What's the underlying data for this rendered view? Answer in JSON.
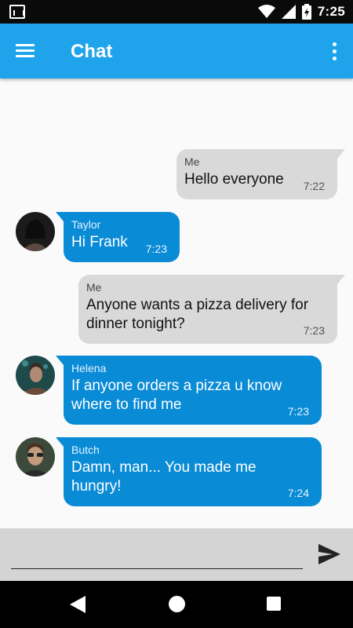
{
  "status_bar": {
    "time": "7:25",
    "icons": [
      "screen-capture-icon",
      "wifi-icon",
      "cellular-signal-icon",
      "battery-charging-icon"
    ]
  },
  "app_bar": {
    "title": "Chat",
    "menu_icon": "hamburger-menu-icon",
    "overflow_icon": "more-vert-icon"
  },
  "messages": [
    {
      "from": "Me",
      "text": "Hello everyone",
      "time": "7:22",
      "outgoing": true
    },
    {
      "from": "Taylor",
      "text": "Hi Frank",
      "time": "7:23",
      "outgoing": false
    },
    {
      "from": "Me",
      "text": "Anyone wants a pizza delivery for dinner tonight?",
      "time": "7:23",
      "outgoing": true
    },
    {
      "from": "Helena",
      "text": "If anyone orders a pizza u know where to find me",
      "time": "7:23",
      "outgoing": false
    },
    {
      "from": "Butch",
      "text": "Damn, man... You made me hungry!",
      "time": "7:24",
      "outgoing": false
    }
  ],
  "composer": {
    "value": "",
    "placeholder": "",
    "send_icon": "send-icon"
  },
  "colors": {
    "app_bar": "#1fa4ec",
    "incoming_bubble": "#0a8bd6",
    "outgoing_bubble": "#d9d9d9",
    "chat_background": "#fafafa",
    "composer_background": "#d4d4d4"
  }
}
